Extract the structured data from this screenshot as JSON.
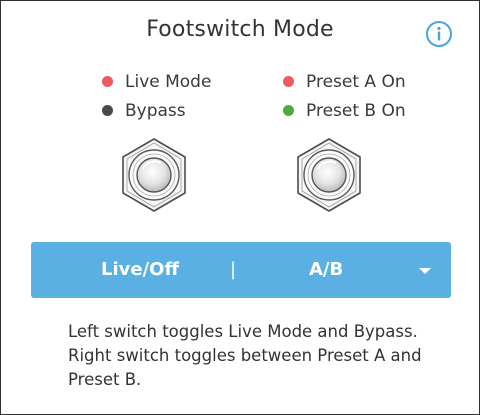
{
  "title": "Footswitch Mode",
  "legend_left": [
    {
      "label": "Live Mode",
      "color": "#ec5b61"
    },
    {
      "label": "Bypass",
      "color": "#4a4a4a"
    }
  ],
  "legend_right": [
    {
      "label": "Preset A On",
      "color": "#ec5b61"
    },
    {
      "label": "Preset B On",
      "color": "#4cae36"
    }
  ],
  "mode_selector": {
    "left_label": "Live/Off",
    "separator": "|",
    "right_label": "A/B"
  },
  "description": "Left switch toggles Live Mode and Bypass. Right switch toggles between Preset A and Preset B.",
  "colors": {
    "accent": "#5ab0e2",
    "info_icon": "#4aa5dd"
  },
  "icons": {
    "info": "info-circle-icon",
    "dropdown": "chevron-down-icon",
    "switch": "footswitch-icon"
  }
}
